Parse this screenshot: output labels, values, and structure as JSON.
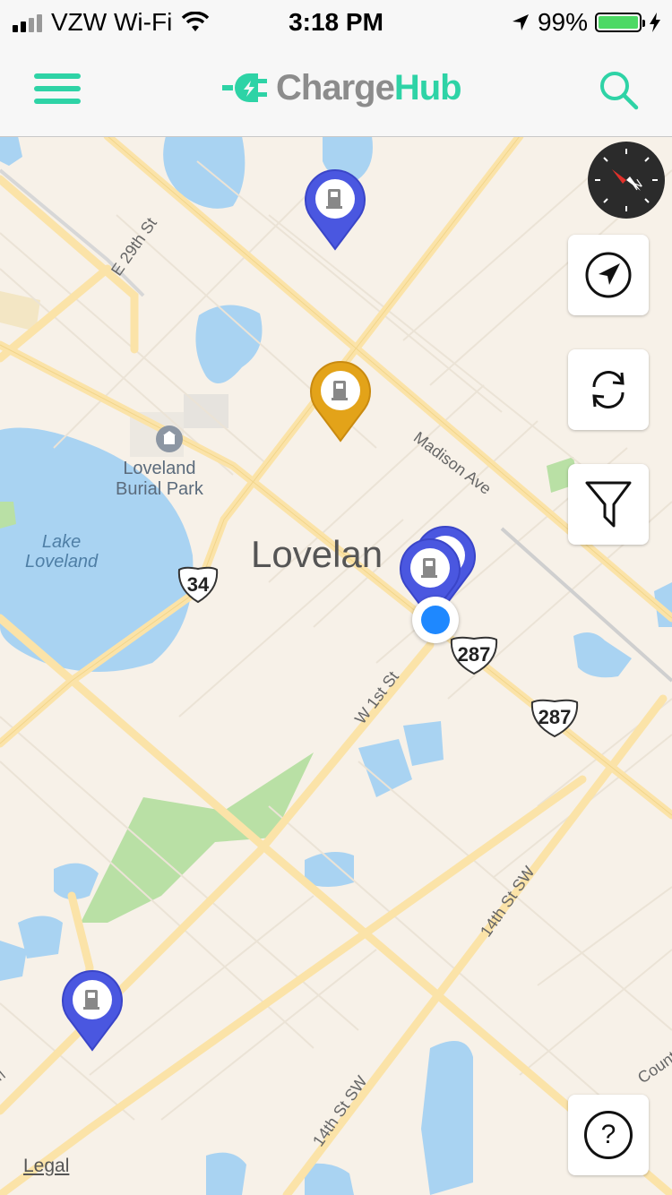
{
  "status_bar": {
    "carrier": "VZW Wi-Fi",
    "time": "3:18 PM",
    "battery_percent": "99%",
    "battery_level": 0.99,
    "wifi_icon": "wifi-icon",
    "location_icon": "location-arrow-icon",
    "charging_icon": "bolt-icon"
  },
  "header": {
    "logo_part1": "Charge",
    "logo_part2": "Hub",
    "menu_icon": "hamburger-icon",
    "search_icon": "search-icon"
  },
  "colors": {
    "brand": "#2ed3a6",
    "logo_gray": "#8c8c8c",
    "pin_blue": "#4a57e0",
    "pin_gold": "#e3a319",
    "user_dot": "#1e88ff",
    "water": "#a9d3f2",
    "park": "#b9e0a5",
    "road": "#fbe3a8"
  },
  "map": {
    "labels": {
      "city": "Lovelan",
      "lake": "Lake\nLoveland",
      "park": "Loveland\nBurial Park",
      "madison": "Madison Ave",
      "e29th": "E 29th St",
      "w1st": "W 1st St",
      "st14a": "14th St SW",
      "st14b": "14th St SW",
      "county": "Count",
      "edge_e": "E"
    },
    "shields": {
      "s34": "34",
      "s287a": "287",
      "s287b": "287"
    }
  },
  "controls": {
    "compass_icon": "compass-icon",
    "locate_icon": "navigate-arrow-icon",
    "refresh_icon": "refresh-icon",
    "filter_icon": "filter-icon",
    "help_label": "?"
  },
  "legal": "Legal"
}
